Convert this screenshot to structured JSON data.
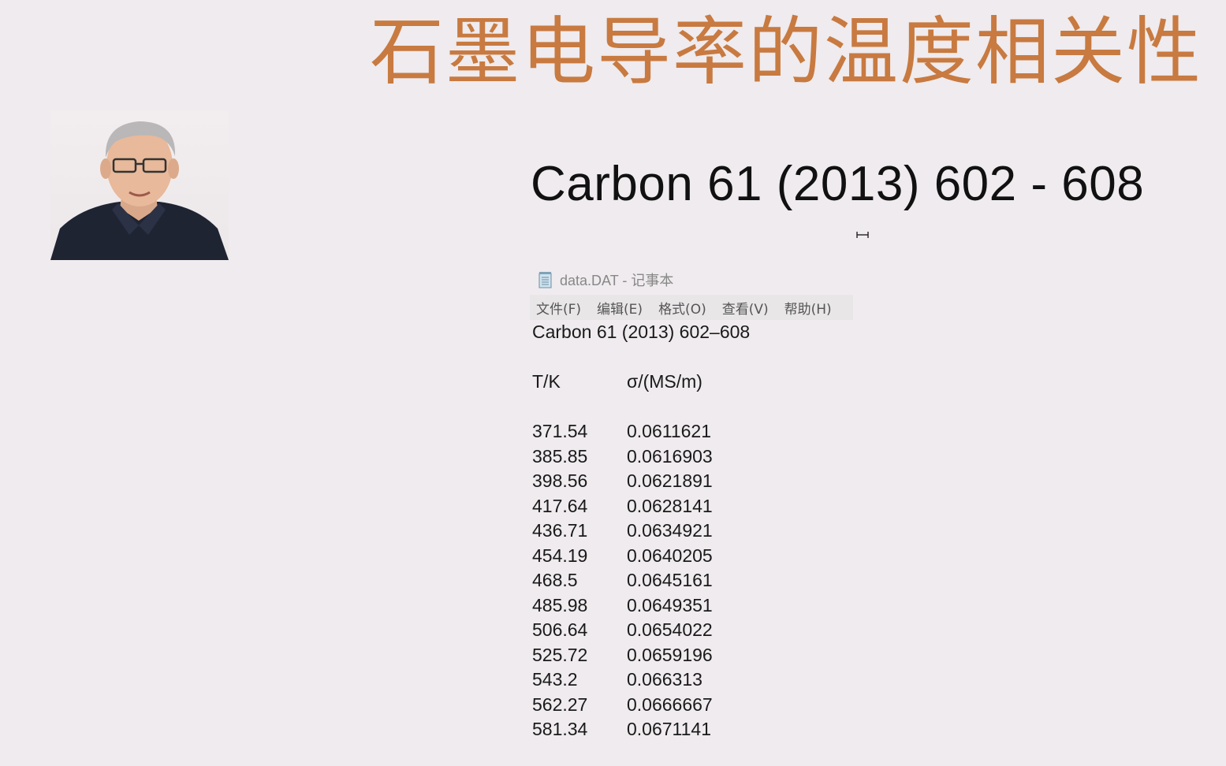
{
  "slide": {
    "title": "石墨电导率的温度相关性",
    "citation": "Carbon 61 (2013) 602 - 608",
    "accent_color": "#c87a40"
  },
  "webcam": {
    "description_icon": "presenter-webcam"
  },
  "notepad": {
    "window_title": "data.DAT - 记事本",
    "app_icon": "notepad-icon",
    "menu": [
      "文件(F)",
      "编辑(E)",
      "格式(O)",
      "查看(V)",
      "帮助(H)"
    ],
    "content": {
      "header_line": "Carbon 61 (2013) 602–608",
      "col_t_header": "T/K",
      "col_s_header": "σ/(MS/m)",
      "rows": [
        {
          "T": "371.54",
          "sigma": "0.0611621"
        },
        {
          "T": "385.85",
          "sigma": "0.0616903"
        },
        {
          "T": "398.56",
          "sigma": "0.0621891"
        },
        {
          "T": "417.64",
          "sigma": "0.0628141"
        },
        {
          "T": "436.71",
          "sigma": "0.0634921"
        },
        {
          "T": "454.19",
          "sigma": "0.0640205"
        },
        {
          "T": "468.5",
          "sigma": "0.0645161"
        },
        {
          "T": "485.98",
          "sigma": "0.0649351"
        },
        {
          "T": "506.64",
          "sigma": "0.0654022"
        },
        {
          "T": "525.72",
          "sigma": "0.0659196"
        },
        {
          "T": "543.2",
          "sigma": "0.066313"
        },
        {
          "T": "562.27",
          "sigma": "0.0666667"
        },
        {
          "T": "581.34",
          "sigma": "0.0671141"
        }
      ]
    }
  }
}
